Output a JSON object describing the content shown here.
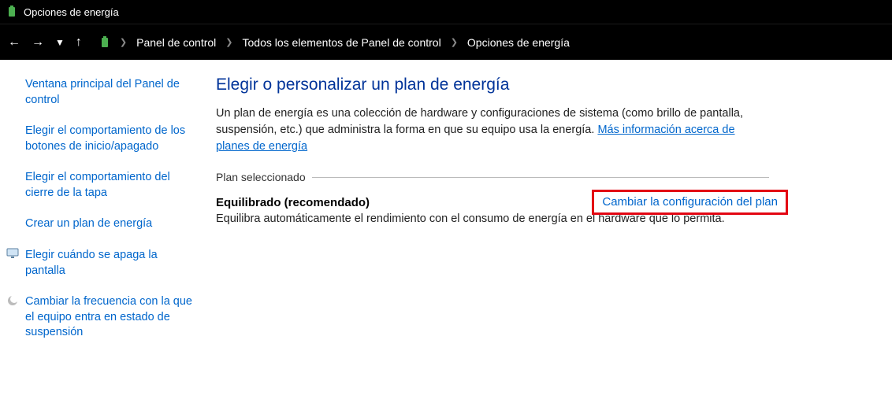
{
  "title": "Opciones de energía",
  "breadcrumb": {
    "items": [
      "Panel de control",
      "Todos los elementos de Panel de control",
      "Opciones de energía"
    ]
  },
  "sidebar": {
    "items": [
      "Ventana principal del Panel de control",
      "Elegir el comportamiento de los botones de inicio/apagado",
      "Elegir el comportamiento del cierre de la tapa",
      "Crear un plan de energía",
      "Elegir cuándo se apaga la pantalla",
      "Cambiar la frecuencia con la que el equipo entra en estado de suspensión"
    ]
  },
  "main": {
    "heading": "Elegir o personalizar un plan de energía",
    "intro_text": "Un plan de energía es una colección de hardware y configuraciones de sistema (como brillo de pantalla, suspensión, etc.) que administra la forma en que su equipo usa la energía. ",
    "intro_link": "Más información acerca de planes de energía",
    "section_label": "Plan seleccionado",
    "plan": {
      "name": "Equilibrado (recomendado)",
      "desc": "Equilibra automáticamente el rendimiento con el consumo de energía en el hardware que lo permita.",
      "link": "Cambiar la configuración del plan"
    }
  }
}
